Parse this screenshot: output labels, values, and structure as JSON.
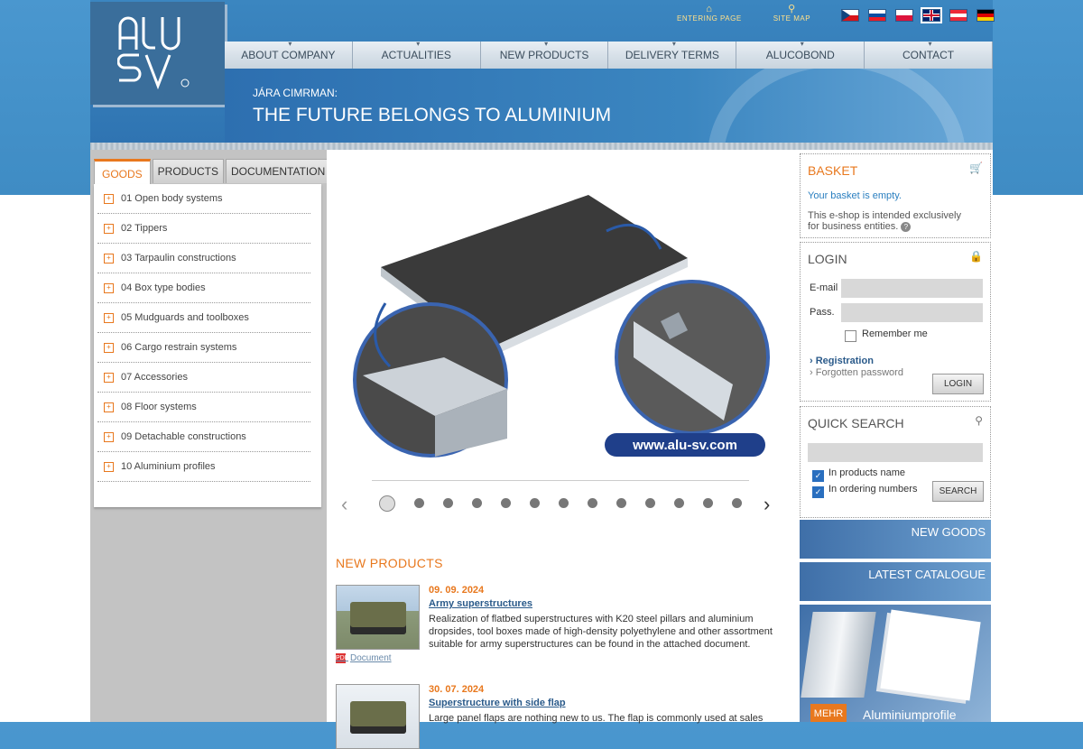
{
  "colors": {
    "accent": "#e8781e",
    "brand_blue": "#2f74b2",
    "link_blue": "#2a5a8a"
  },
  "header": {
    "top_links": [
      {
        "label": "ENTERING PAGE",
        "icon": "home-icon",
        "glyph": "⌂"
      },
      {
        "label": "SITE MAP",
        "icon": "sitemap-icon",
        "glyph": "⚲"
      }
    ],
    "flags": [
      "cz",
      "sk",
      "pl",
      "en",
      "at",
      "de"
    ],
    "nav": [
      "ABOUT COMPANY",
      "ACTUALITIES",
      "NEW PRODUCTS",
      "DELIVERY TERMS",
      "ALUCOBOND",
      "CONTACT"
    ],
    "banner_sub": "JÁRA CIMRMAN:",
    "banner_title": "THE FUTURE BELONGS TO ALUMINIUM"
  },
  "tabs": {
    "goods": "GOODS",
    "products": "PRODUCTS",
    "documentation": "DOCUMENTATION"
  },
  "categories": [
    "01 Open body systems",
    "02 Tippers",
    "03 Tarpaulin constructions",
    "04 Box type bodies",
    "05 Mudguards and toolboxes",
    "06 Cargo restrain systems",
    "07 Accessories",
    "08 Floor systems",
    "09 Detachable constructions",
    "10 Aluminium profiles"
  ],
  "slider": {
    "url_text": "www.alu-sv.com",
    "active_index": 0,
    "count": 13
  },
  "news": {
    "heading": "NEW PRODUCTS",
    "items": [
      {
        "date": "09. 09. 2024",
        "title": "Army superstructures",
        "desc": "Realization of flatbed superstructures with K20 steel pillars and aluminium dropsides, tool boxes made of high-density polyethylene and other assortment suitable for army superstructures can be found in the attached document.",
        "doc_label": "Document"
      },
      {
        "date": "30. 07. 2024",
        "title": "Superstructure with side flap",
        "desc": "Large panel flaps are nothing new to us. The flap is commonly used at sales"
      }
    ]
  },
  "basket": {
    "heading": "BASKET",
    "empty": "Your basket is empty.",
    "note": "This e-shop is intended exclusively for business entities."
  },
  "login": {
    "heading": "LOGIN",
    "email_label": "E-mail",
    "pass_label": "Pass.",
    "remember": "Remember me",
    "registration": "Registration",
    "forgot": "Forgotten password",
    "button": "LOGIN"
  },
  "search": {
    "heading": "QUICK SEARCH",
    "opt1": "In products name",
    "opt2": "In ordering numbers",
    "button": "SEARCH"
  },
  "promos": {
    "new_goods": "NEW GOODS",
    "catalogue": "LATEST CATALOGUE",
    "mehr": "MEHR",
    "profiles": "Aluminiumprofile"
  }
}
